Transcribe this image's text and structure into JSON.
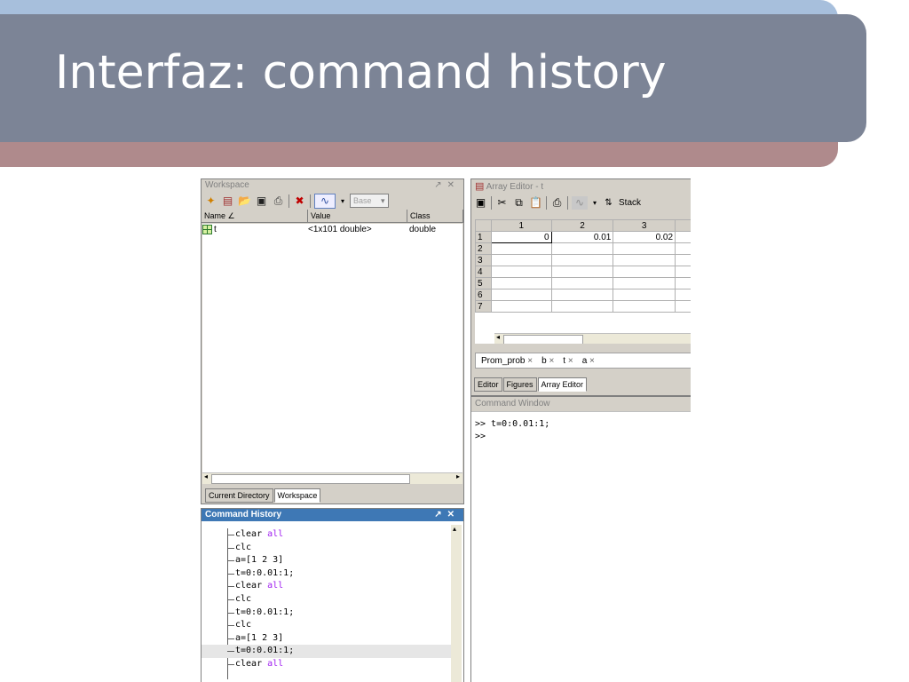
{
  "slide": {
    "title": "Interfaz: command history"
  },
  "workspace": {
    "title": "Workspace",
    "base_label": "Base",
    "columns": [
      "Name",
      "Value",
      "Class"
    ],
    "rows": [
      {
        "name": "t",
        "value": "<1x101 double>",
        "class": "double"
      }
    ],
    "tabs": [
      "Current Directory",
      "Workspace"
    ]
  },
  "history": {
    "title": "Command History",
    "lines": [
      {
        "cmd": "clear",
        "arg": "all"
      },
      {
        "cmd": "clc",
        "arg": ""
      },
      {
        "cmd": "a=[1 2 3]",
        "arg": ""
      },
      {
        "cmd": "t=0:0.01:1;",
        "arg": ""
      },
      {
        "cmd": "clear",
        "arg": "all"
      },
      {
        "cmd": "clc",
        "arg": ""
      },
      {
        "cmd": "t=0:0.01:1;",
        "arg": ""
      },
      {
        "cmd": "clc",
        "arg": ""
      },
      {
        "cmd": "a=[1 2 3]",
        "arg": ""
      },
      {
        "cmd": "t=0:0.01:1;",
        "arg": ""
      },
      {
        "cmd": "clear",
        "arg": "all"
      }
    ]
  },
  "array_editor": {
    "title": "Array Editor - t",
    "stack_label": "Stack",
    "columns": [
      "1",
      "2",
      "3"
    ],
    "row_labels": [
      "1",
      "2",
      "3",
      "4",
      "5",
      "6",
      "7"
    ],
    "first_row": [
      "0",
      "0.01",
      "0.02"
    ],
    "var_tabs": [
      "Prom_prob",
      "b",
      "t",
      "a"
    ],
    "doc_tabs": [
      "Editor",
      "Figures",
      "Array Editor"
    ]
  },
  "command_window": {
    "title": "Command Window",
    "lines": [
      ">> t=0:0.01:1;",
      ">>"
    ]
  }
}
